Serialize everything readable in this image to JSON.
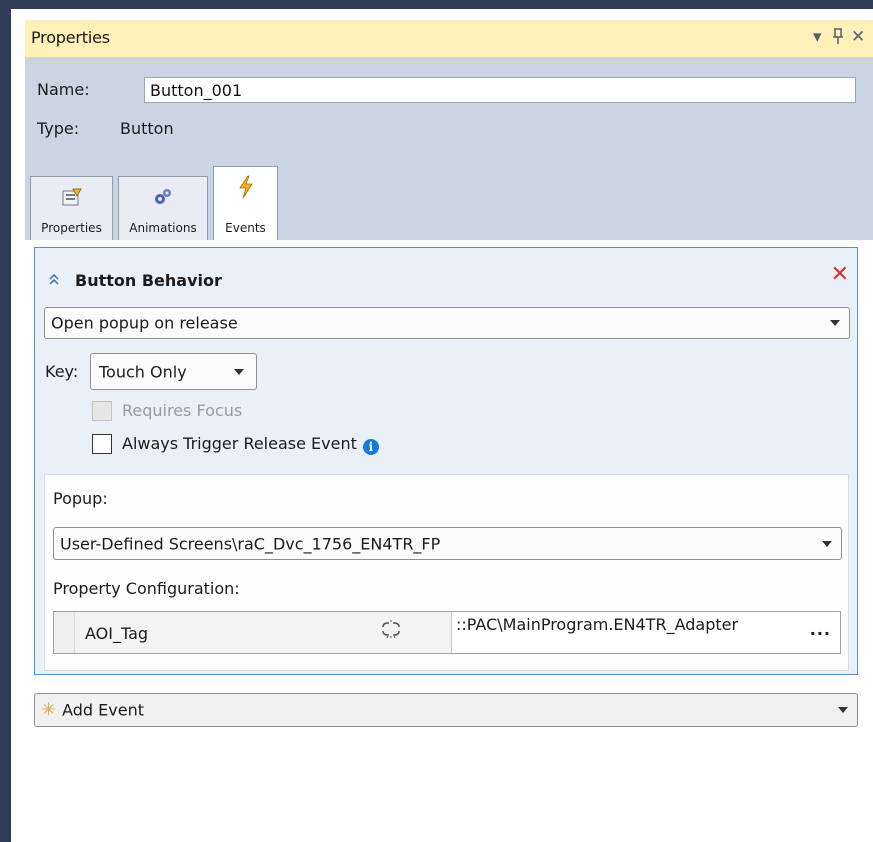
{
  "window": {
    "title": "Properties",
    "menu_glyph": "▾",
    "pin_glyph": "ᛘ",
    "close_glyph": "✕"
  },
  "header": {
    "name_label": "Name:",
    "name_value": "Button_001",
    "type_label": "Type:",
    "type_value": "Button"
  },
  "tabs": [
    {
      "label": "Properties",
      "icon": "properties-icon"
    },
    {
      "label": "Animations",
      "icon": "animations-icon"
    },
    {
      "label": "Events",
      "icon": "events-icon",
      "active": true
    }
  ],
  "event_panel": {
    "title": "Button Behavior",
    "action": "Open popup on release",
    "key_label": "Key:",
    "key_value": "Touch Only",
    "requires_focus_label": "Requires Focus",
    "requires_focus_enabled": false,
    "always_trigger_label": "Always Trigger Release Event",
    "always_trigger_checked": false,
    "popup_label": "Popup:",
    "popup_value": "User-Defined Screens\\raC_Dvc_1756_EN4TR_FP",
    "property_config_label": "Property Configuration:",
    "property_name": "AOI_Tag",
    "property_value": "::PAC\\MainProgram.EN4TR_Adapter",
    "ellipsis": "..."
  },
  "add_event": {
    "label": "Add Event"
  },
  "colors": {
    "frame": "#2e3d55",
    "titlebar": "#fdf0b9",
    "header_bg": "#cbd4e2",
    "panel_border": "#5b8ed8",
    "panel_bg": "#eaf0f8",
    "remove_red": "#d9342b",
    "info_blue": "#1979d8"
  }
}
